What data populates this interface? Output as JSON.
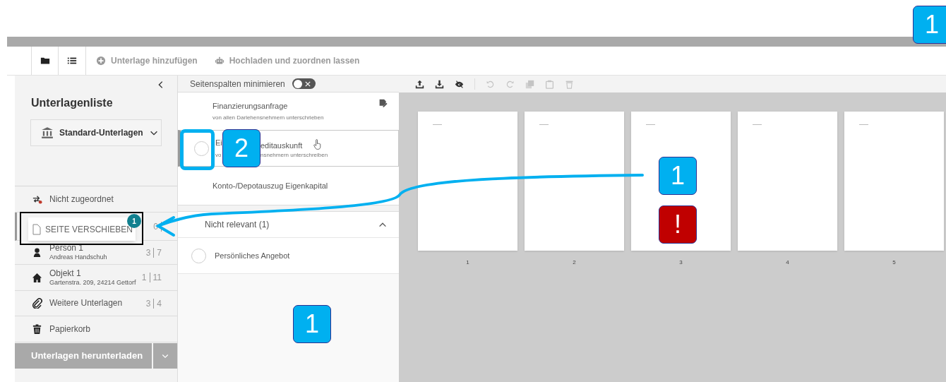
{
  "tabs": [
    {
      "kind": "folder",
      "selected": true
    },
    {
      "kind": "list",
      "selected": false
    }
  ],
  "actions": [
    {
      "kind": "add",
      "label": "Unterlage hinzufügen"
    },
    {
      "kind": "robot",
      "label": "Hochladen und zuordnen lassen"
    }
  ],
  "sidebar": {
    "title": "Unterlagenliste",
    "dropdown": "Standard-Unterlagen",
    "items": [
      {
        "kind": "unassigned",
        "label": "Nicht zugeordnet",
        "selected": false
      },
      {
        "kind": "hidden",
        "count_a": "0",
        "selected": true
      },
      {
        "kind": "person",
        "label": "Person 1",
        "sublabel": "Andreas Handschuh",
        "count_a": "3",
        "count_b": "7",
        "selected": false
      },
      {
        "kind": "house",
        "label": "Objekt 1",
        "sublabel": "Gartenstra. 209, 24214 Gettorf",
        "count_a": "1",
        "count_b": "11",
        "selected": false
      },
      {
        "kind": "attachment",
        "label": "Weitere Unterlagen",
        "count_a": "3",
        "count_b": "4",
        "selected": false
      },
      {
        "kind": "trash",
        "label": "Papierkorb",
        "selected": false
      }
    ],
    "download_button": "Unterlagen herunterladen"
  },
  "documents_panel": {
    "toggle_label": "Seitenspalten minimieren",
    "toggle_on": false,
    "documents": [
      {
        "title_parts": [
          "Finanzierungsanfrage"
        ],
        "subtitle_parts": [
          "von allen Darlehensnehmern unterschrieben"
        ],
        "editable": true,
        "selected": false
      },
      {
        "title_parts": [
          "Ei",
          "editauskunft"
        ],
        "subtitle_parts": [
          "vo",
          "nsnehmern unterschreiben"
        ],
        "checked": false,
        "selected": true
      },
      {
        "title_parts": [
          "Konto-/Depotauszug Eigenkapital"
        ],
        "selected": false
      }
    ],
    "section": {
      "title": "Nicht relevant (1)",
      "expanded": true,
      "documents": [
        {
          "title": "Persönliches Angebot",
          "checked": false
        }
      ]
    }
  },
  "page_toolbar": [
    {
      "kind": "upload",
      "disabled": false
    },
    {
      "kind": "download",
      "disabled": false
    },
    {
      "kind": "hide",
      "disabled": false
    },
    {
      "kind": "undo",
      "disabled": true
    },
    {
      "kind": "redo",
      "disabled": true
    },
    {
      "kind": "copy",
      "disabled": true
    },
    {
      "kind": "paste",
      "disabled": true
    },
    {
      "kind": "delete",
      "disabled": true
    }
  ],
  "pages": [
    {
      "number": "1"
    },
    {
      "number": "2"
    },
    {
      "number": "3"
    },
    {
      "number": "4"
    },
    {
      "number": "5"
    }
  ],
  "drag_popup": {
    "label": "SEITE VERSCHIEBEN",
    "badge": "1"
  },
  "callouts": [
    {
      "kind": "step",
      "text": "1"
    },
    {
      "kind": "step",
      "text": "2"
    },
    {
      "kind": "step",
      "text": "1"
    },
    {
      "kind": "warning",
      "text": "!"
    },
    {
      "kind": "step",
      "text": "1"
    }
  ]
}
